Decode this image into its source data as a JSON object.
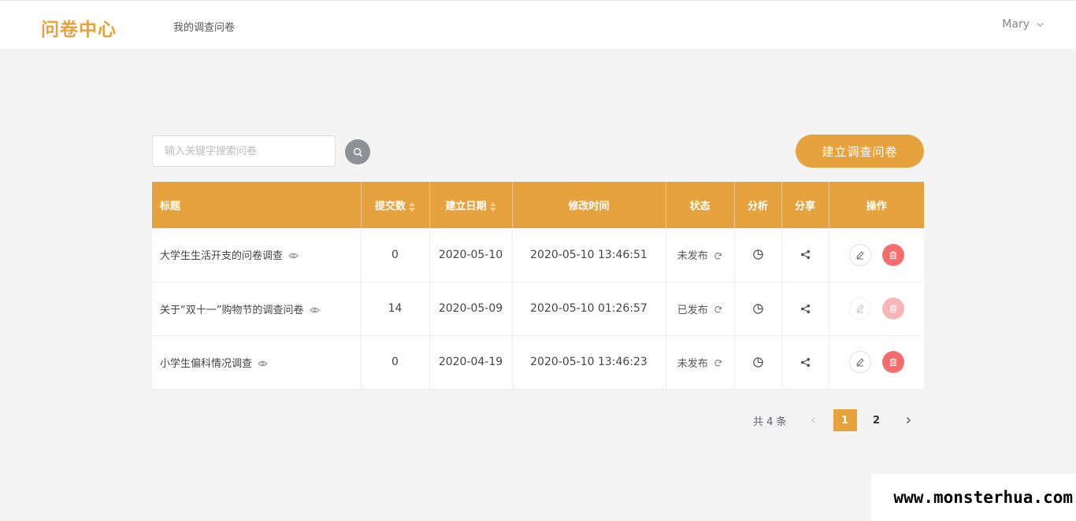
{
  "header": {
    "logo": "问卷中心",
    "nav_my_surveys": "我的调查问卷",
    "user_name": "Mary"
  },
  "toolbar": {
    "search_placeholder": "输入关键字搜索问卷",
    "create_label": "建立调查问卷"
  },
  "table": {
    "headers": {
      "title": "标题",
      "submissions": "提交数",
      "created": "建立日期",
      "modified": "修改时间",
      "status": "状态",
      "analysis": "分析",
      "share": "分享",
      "actions": "操作"
    },
    "rows": [
      {
        "title": "大学生生活开支的问卷调查",
        "submissions": "0",
        "created": "2020-05-10",
        "modified": "2020-05-10 13:46:51",
        "status": "未发布",
        "actions_enabled": true
      },
      {
        "title": "关于“双十一”购物节的调查问卷",
        "submissions": "14",
        "created": "2020-05-09",
        "modified": "2020-05-10 01:26:57",
        "status": "已发布",
        "actions_enabled": false
      },
      {
        "title": "小学生偏科情况调查",
        "submissions": "0",
        "created": "2020-04-19",
        "modified": "2020-05-10 13:46:23",
        "status": "未发布",
        "actions_enabled": true
      }
    ]
  },
  "pagination": {
    "total": "共 4 条",
    "pages": [
      "1",
      "2"
    ],
    "current": "1"
  },
  "watermark": "www.monsterhua.com",
  "colors": {
    "accent": "#e6a23c",
    "danger": "#f56c6c",
    "background": "#f4f4f4"
  },
  "icons": {
    "search": "search-icon",
    "dropdown": "chevron-down-icon",
    "preview": "eye-icon",
    "status_toggle": "refresh-icon",
    "analysis": "pie-chart-icon",
    "share": "share-icon",
    "edit": "edit-icon",
    "delete": "trash-icon"
  }
}
